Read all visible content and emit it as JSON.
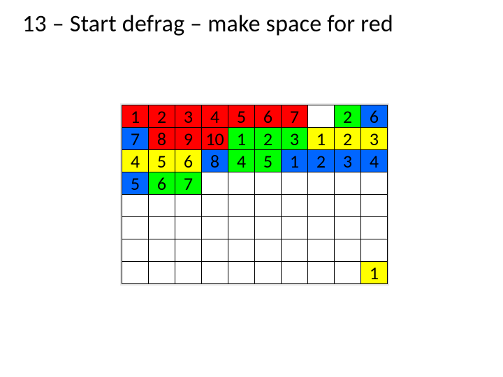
{
  "title": "13 – Start defrag – make space for red",
  "colors": {
    "red": "#ff0000",
    "green": "#00ff00",
    "yellow": "#ffff00",
    "blue": "#0066ff",
    "white": "#ffffff",
    "grid_bg": "#e8e8e8"
  },
  "grid": {
    "cols": 10,
    "rows": 8,
    "cells": [
      [
        {
          "v": "1",
          "c": "red"
        },
        {
          "v": "2",
          "c": "red"
        },
        {
          "v": "3",
          "c": "red"
        },
        {
          "v": "4",
          "c": "red"
        },
        {
          "v": "5",
          "c": "red"
        },
        {
          "v": "6",
          "c": "red"
        },
        {
          "v": "7",
          "c": "red"
        },
        {
          "v": "",
          "c": "white"
        },
        {
          "v": "2",
          "c": "green"
        },
        {
          "v": "6",
          "c": "blue"
        }
      ],
      [
        {
          "v": "7",
          "c": "blue"
        },
        {
          "v": "8",
          "c": "red"
        },
        {
          "v": "9",
          "c": "red"
        },
        {
          "v": "10",
          "c": "red"
        },
        {
          "v": "1",
          "c": "green"
        },
        {
          "v": "2",
          "c": "green"
        },
        {
          "v": "3",
          "c": "green"
        },
        {
          "v": "1",
          "c": "yellow"
        },
        {
          "v": "2",
          "c": "yellow"
        },
        {
          "v": "3",
          "c": "yellow"
        }
      ],
      [
        {
          "v": "4",
          "c": "yellow"
        },
        {
          "v": "5",
          "c": "yellow"
        },
        {
          "v": "6",
          "c": "yellow"
        },
        {
          "v": "8",
          "c": "blue"
        },
        {
          "v": "4",
          "c": "green"
        },
        {
          "v": "5",
          "c": "green"
        },
        {
          "v": "1",
          "c": "blue"
        },
        {
          "v": "2",
          "c": "blue"
        },
        {
          "v": "3",
          "c": "blue"
        },
        {
          "v": "4",
          "c": "blue"
        }
      ],
      [
        {
          "v": "5",
          "c": "blue"
        },
        {
          "v": "6",
          "c": "green"
        },
        {
          "v": "7",
          "c": "green"
        },
        {
          "v": "",
          "c": "white"
        },
        {
          "v": "",
          "c": "white"
        },
        {
          "v": "",
          "c": "white"
        },
        {
          "v": "",
          "c": "white"
        },
        {
          "v": "",
          "c": "white"
        },
        {
          "v": "",
          "c": "white"
        },
        {
          "v": "",
          "c": "white"
        }
      ],
      [
        {
          "v": "",
          "c": "white"
        },
        {
          "v": "",
          "c": "white"
        },
        {
          "v": "",
          "c": "white"
        },
        {
          "v": "",
          "c": "white"
        },
        {
          "v": "",
          "c": "white"
        },
        {
          "v": "",
          "c": "white"
        },
        {
          "v": "",
          "c": "white"
        },
        {
          "v": "",
          "c": "white"
        },
        {
          "v": "",
          "c": "white"
        },
        {
          "v": "",
          "c": "white"
        }
      ],
      [
        {
          "v": "",
          "c": "white"
        },
        {
          "v": "",
          "c": "white"
        },
        {
          "v": "",
          "c": "white"
        },
        {
          "v": "",
          "c": "white"
        },
        {
          "v": "",
          "c": "white"
        },
        {
          "v": "",
          "c": "white"
        },
        {
          "v": "",
          "c": "white"
        },
        {
          "v": "",
          "c": "white"
        },
        {
          "v": "",
          "c": "white"
        },
        {
          "v": "",
          "c": "white"
        }
      ],
      [
        {
          "v": "",
          "c": "white"
        },
        {
          "v": "",
          "c": "white"
        },
        {
          "v": "",
          "c": "white"
        },
        {
          "v": "",
          "c": "white"
        },
        {
          "v": "",
          "c": "white"
        },
        {
          "v": "",
          "c": "white"
        },
        {
          "v": "",
          "c": "white"
        },
        {
          "v": "",
          "c": "white"
        },
        {
          "v": "",
          "c": "white"
        },
        {
          "v": "",
          "c": "white"
        }
      ],
      [
        {
          "v": "",
          "c": "white"
        },
        {
          "v": "",
          "c": "white"
        },
        {
          "v": "",
          "c": "white"
        },
        {
          "v": "",
          "c": "white"
        },
        {
          "v": "",
          "c": "white"
        },
        {
          "v": "",
          "c": "white"
        },
        {
          "v": "",
          "c": "white"
        },
        {
          "v": "",
          "c": "white"
        },
        {
          "v": "",
          "c": "white"
        },
        {
          "v": "1",
          "c": "yellow"
        }
      ]
    ]
  }
}
